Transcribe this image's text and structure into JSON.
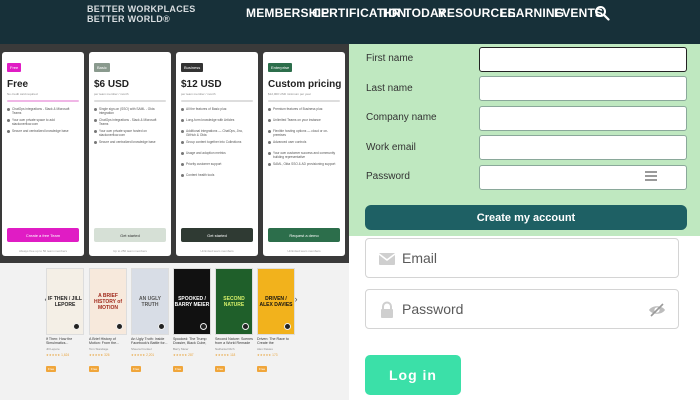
{
  "header": {
    "brand_line1": "BETTER WORKPLACES",
    "brand_line2": "BETTER WORLD®",
    "nav": [
      "MEMBERSHIP",
      "CERTIFICATION",
      "HR TODAY",
      "RESOURCES",
      "LEARNING",
      "EVENTS"
    ],
    "background": "#173039"
  },
  "pricing": {
    "plans": [
      {
        "badge": "Free",
        "badge_color": "#e01cc4",
        "name": "Free",
        "sub": "No credit card required",
        "divider_color": "#f0b6e6",
        "features": [
          "ChatOps integrations - Slack & Microsoft Teams",
          "Your own private space to add stackoverflow.com",
          "Secure and centralized knowledge base"
        ],
        "button": "Create a free Team",
        "button_color": "#e01cc4",
        "footer": "Always free up to 50 team members"
      },
      {
        "badge": "Basic",
        "badge_color": "#8a9a8e",
        "name": "$6 USD",
        "sub": "per team member / month",
        "divider_color": "#dddddd",
        "features": [
          "Single sign-on (SSO) with SAML - Okta integration",
          "ChatOps integrations - Slack & Microsoft Teams",
          "Your own private space hosted on stackoverflow.com",
          "Secure and centralized knowledge base"
        ],
        "button": "Get started",
        "button_color": "#d6e0d6",
        "footer": "Up to 250 team members"
      },
      {
        "badge": "Business",
        "badge_color": "#333333",
        "name": "$12 USD",
        "sub": "per team member / month",
        "divider_color": "#dddddd",
        "features": [
          "All the features of Basic plus:",
          "Long-form knowledge with Articles",
          "Additional integrations — ChatOps, Jira, GitHub & Okta",
          "Group content together into Collections",
          "Usage and adoption metrics",
          "Priority customer support",
          "Content health tools"
        ],
        "button": "Get started",
        "button_color": "#2f3a33",
        "footer": "Unlimited team members"
      },
      {
        "badge": "Enterprise",
        "badge_color": "#2c6e4b",
        "name": "Custom pricing",
        "sub": "$12,000 USD minimum per year",
        "divider_color": "#dddddd",
        "features": [
          "Premium features of Business plus:",
          "Unlimited Teams on your instance",
          "Flexible hosting options — cloud or on-premises",
          "Advanced user controls",
          "Your own customer success and community building representative",
          "SAML, Okta SSO & AD provisioning support"
        ],
        "button": "Request a demo",
        "button_color": "#2c6e4b",
        "footer": "Unlimited team members"
      }
    ]
  },
  "books": {
    "items": [
      {
        "title": "If Then: How the Simulmatics...",
        "author": "Jill Lepore",
        "rating": "★★★★★ 1,624",
        "tag": "Free",
        "cover_bg": "#f4efe6",
        "cover_fg": "#222222",
        "cover_text": "IF THEN / JILL LEPORE"
      },
      {
        "title": "A Brief History of Motion: From the...",
        "author": "Tom Standage",
        "rating": "★★★★★ 326",
        "tag": "Free",
        "cover_bg": "#f7e9dc",
        "cover_fg": "#a12a1c",
        "cover_text": "A BRIEF HISTORY of MOTION"
      },
      {
        "title": "An Ugly Truth: Inside Facebook's Battle for...",
        "author": "Sheera Frenkel",
        "rating": "★★★★★ 2,201",
        "tag": "Free",
        "cover_bg": "#d8dde6",
        "cover_fg": "#555555",
        "cover_text": "AN UGLY TRUTH"
      },
      {
        "title": "Spooked: The Trump Dossier, Black Cube, and...",
        "author": "Barry Meier",
        "rating": "★★★★★ 287",
        "tag": "Free",
        "cover_bg": "#111111",
        "cover_fg": "#ffffff",
        "cover_text": "SPOOKED / BARRY MEIER"
      },
      {
        "title": "Second Nature: Scenes from a World Remade",
        "author": "Nathaniel Rich",
        "rating": "★★★★★ 118",
        "tag": "Free",
        "cover_bg": "#1f5f2a",
        "cover_fg": "#d6f06a",
        "cover_text": "SECOND NATURE"
      },
      {
        "title": "Driven: The Race to Create the Autonomous...",
        "author": "Alex Davies",
        "rating": "★★★★★ 173",
        "tag": "Free",
        "cover_bg": "#f2b21c",
        "cover_fg": "#111111",
        "cover_text": "DRIVEN / ALEX DAVIES"
      }
    ],
    "prev_arrow": "‹",
    "next_arrow": "›"
  },
  "signup": {
    "fields": [
      {
        "label": "First name",
        "value": ""
      },
      {
        "label": "Last name",
        "value": ""
      },
      {
        "label": "Company name",
        "value": ""
      },
      {
        "label": "Work email",
        "value": ""
      },
      {
        "label": "Password",
        "value": ""
      }
    ],
    "submit": "Create my account",
    "background": "#bfe8c0",
    "button_color": "#1e6064"
  },
  "login": {
    "email_placeholder": "Email",
    "password_placeholder": "Password",
    "submit": "Log in",
    "button_color": "#3be0a8"
  },
  "icons": {
    "search": "search-icon",
    "mail": "mail-icon",
    "lock": "lock-icon",
    "eye_off": "eye-off-icon",
    "password_keys": "password-manager-icon"
  }
}
